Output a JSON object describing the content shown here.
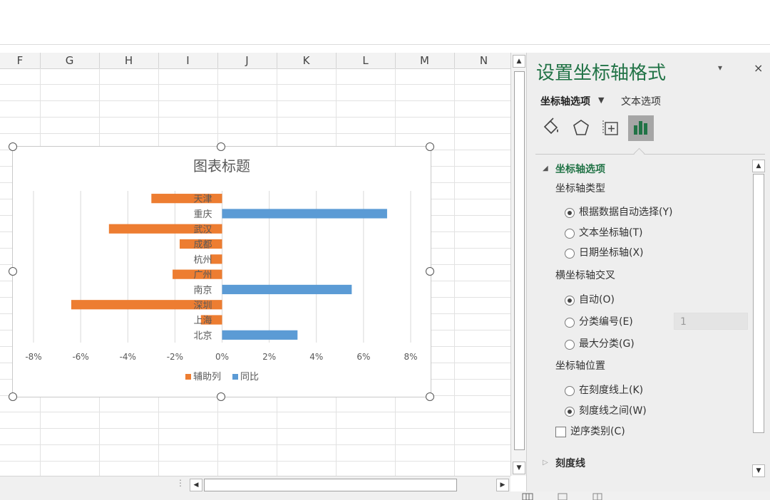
{
  "sheet": {
    "columns": [
      "F",
      "G",
      "H",
      "I",
      "J",
      "K",
      "L",
      "M",
      "N"
    ]
  },
  "chart_data": {
    "type": "bar",
    "orientation": "horizontal",
    "title": "图表标题",
    "categories": [
      "天津",
      "重庆",
      "武汉",
      "成都",
      "杭州",
      "广州",
      "南京",
      "深圳",
      "上海",
      "北京"
    ],
    "series": [
      {
        "name": "辅助列",
        "color": "#ed7d31",
        "values": [
          -0.03,
          null,
          -0.048,
          -0.018,
          -0.005,
          -0.021,
          null,
          -0.064,
          -0.009,
          null
        ]
      },
      {
        "name": "同比",
        "color": "#5b9bd5",
        "values": [
          null,
          0.07,
          null,
          null,
          null,
          null,
          0.055,
          null,
          null,
          0.032
        ]
      }
    ],
    "x_ticks": [
      "-8%",
      "-6%",
      "-4%",
      "-2%",
      "0%",
      "2%",
      "4%",
      "6%",
      "8%"
    ],
    "xlim": [
      -0.08,
      0.08
    ],
    "grid": true,
    "legend_position": "bottom"
  },
  "pane": {
    "title": "设置坐标轴格式",
    "collapse_icon": "chevron-down-icon",
    "close_label": "×",
    "tab_axis_options": "坐标轴选项",
    "tab_text_options": "文本选项",
    "icons": [
      "fill-line-icon",
      "effects-pentagon-icon",
      "size-properties-icon",
      "axis-options-bar-chart-icon"
    ],
    "section_axis_options": "坐标轴选项",
    "axis_type_label": "坐标轴类型",
    "axis_type_options": [
      {
        "label": "根据数据自动选择(Y)",
        "selected": true
      },
      {
        "label": "文本坐标轴(T)",
        "selected": false
      },
      {
        "label": "日期坐标轴(X)",
        "selected": false
      }
    ],
    "cross_label": "横坐标轴交叉",
    "cross_options": [
      {
        "label": "自动(O)",
        "selected": true
      },
      {
        "label": "分类编号(E)",
        "selected": false
      },
      {
        "label": "最大分类(G)",
        "selected": false
      }
    ],
    "cross_number_value": "1",
    "position_label": "坐标轴位置",
    "position_options": [
      {
        "label": "在刻度线上(K)",
        "selected": false
      },
      {
        "label": "刻度线之间(W)",
        "selected": true
      }
    ],
    "reverse_label": "逆序类别(C)",
    "tick_marks_section": "刻度线"
  }
}
